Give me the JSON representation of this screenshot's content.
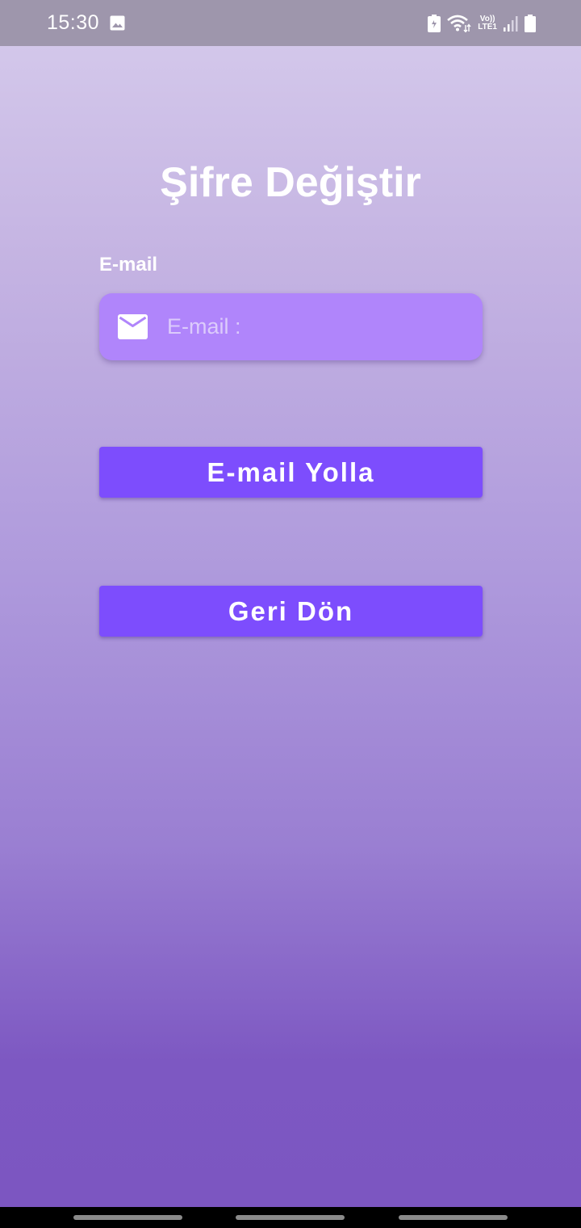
{
  "status_bar": {
    "time": "15:30",
    "volte_label_top": "Vo))",
    "volte_label_bottom": "LTE1"
  },
  "page": {
    "title": "Şifre Değiştir"
  },
  "form": {
    "email_label": "E-mail",
    "email_placeholder": "E-mail :",
    "email_value": "",
    "email_icon": "mail-icon"
  },
  "actions": {
    "send_label": "E-mail Yolla",
    "back_label": "Geri Dön"
  },
  "colors": {
    "button_bg": "#7d4dfd",
    "input_bg": "#b085fb",
    "gradient_top": "#d6cbec",
    "gradient_bottom": "#7c56c1",
    "status_bar_bg": "#9e96ac"
  }
}
